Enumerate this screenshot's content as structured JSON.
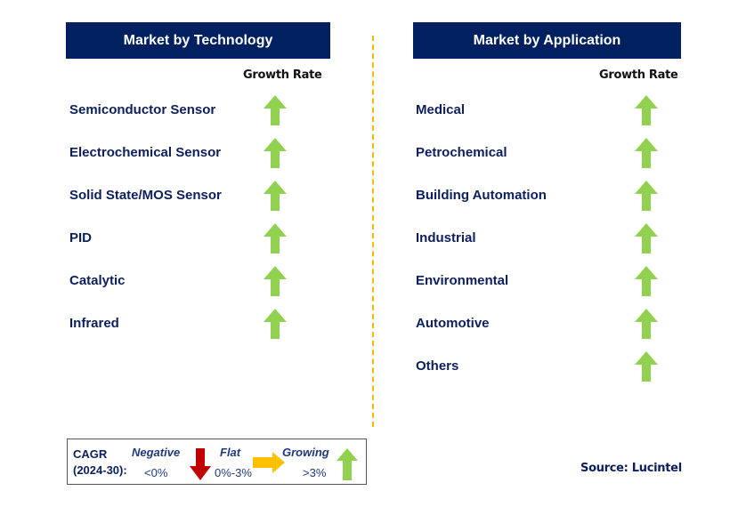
{
  "colors": {
    "header": "#002060",
    "growing": "#92d050",
    "flat": "#ffc000",
    "negative": "#c00000",
    "divider": "#f5b800"
  },
  "technology": {
    "title": "Market by Technology",
    "growth_rate_label": "Growth Rate",
    "items": [
      {
        "label": "Semiconductor Sensor",
        "trend": "growing"
      },
      {
        "label": "Electrochemical Sensor",
        "trend": "growing"
      },
      {
        "label": "Solid State/MOS Sensor",
        "trend": "growing"
      },
      {
        "label": "PID",
        "trend": "growing"
      },
      {
        "label": "Catalytic",
        "trend": "growing"
      },
      {
        "label": "Infrared",
        "trend": "growing"
      }
    ]
  },
  "application": {
    "title": "Market by Application",
    "growth_rate_label": "Growth Rate",
    "items": [
      {
        "label": "Medical",
        "trend": "growing"
      },
      {
        "label": "Petrochemical",
        "trend": "growing"
      },
      {
        "label": "Building Automation",
        "trend": "growing"
      },
      {
        "label": "Industrial",
        "trend": "growing"
      },
      {
        "label": "Environmental",
        "trend": "growing"
      },
      {
        "label": "Automotive",
        "trend": "growing"
      },
      {
        "label": "Others",
        "trend": "growing"
      }
    ]
  },
  "legend": {
    "cagr_line1": "CAGR",
    "cagr_line2": "(2024-30):",
    "negative": "Negative",
    "negative_range": "<0%",
    "flat": "Flat",
    "flat_range": "0%-3%",
    "growing": "Growing",
    "growing_range": ">3%"
  },
  "source": "Source: Lucintel"
}
